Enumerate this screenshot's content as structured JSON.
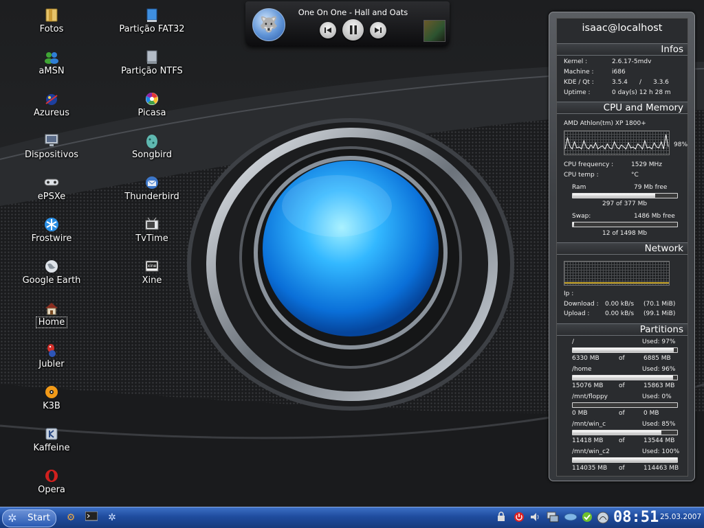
{
  "desktop": {
    "icons_left": [
      {
        "label": "Fotos",
        "icon": "folder-icon"
      },
      {
        "label": "aMSN",
        "icon": "amsn-icon"
      },
      {
        "label": "Azureus",
        "icon": "azureus-frog-icon"
      },
      {
        "label": "Dispositivos",
        "icon": "devices-monitor-icon"
      },
      {
        "label": "ePSXe",
        "icon": "gamepad-icon"
      },
      {
        "label": "Frostwire",
        "icon": "frostwire-icon"
      },
      {
        "label": "Google Earth",
        "icon": "globe-icon"
      },
      {
        "label": "Home",
        "icon": "home-icon"
      },
      {
        "label": "Jubler",
        "icon": "jubler-bird-icon"
      },
      {
        "label": "K3B",
        "icon": "k3b-disc-icon"
      },
      {
        "label": "Kaffeine",
        "icon": "kaffeine-icon"
      },
      {
        "label": "Opera",
        "icon": "opera-icon"
      }
    ],
    "icons_right": [
      {
        "label": "Partição FAT32",
        "icon": "drive-fat32-icon"
      },
      {
        "label": "Partição NTFS",
        "icon": "drive-ntfs-icon"
      },
      {
        "label": "Picasa",
        "icon": "picasa-icon"
      },
      {
        "label": "Songbird",
        "icon": "songbird-egg-icon"
      },
      {
        "label": "Thunderbird",
        "icon": "thunderbird-icon"
      },
      {
        "label": "TvTime",
        "icon": "tv-icon"
      },
      {
        "label": "Xine",
        "icon": "xine-icon"
      }
    ],
    "selected": "Home"
  },
  "player": {
    "track": "One On One - Hall and Oats",
    "logo_icon": "wolf-logo-icon",
    "prev_icon": "previous-track-icon",
    "pause_icon": "pause-icon",
    "next_icon": "next-track-icon"
  },
  "sysinfo": {
    "user": "isaac@localhost",
    "sections": {
      "infos": "Infos",
      "cpu_mem": "CPU and Memory",
      "network": "Network",
      "partitions": "Partitions"
    },
    "infos": {
      "kernel_label": "Kernel :",
      "kernel": "2.6.17-5mdv",
      "machine_label": "Machine :",
      "machine": "i686",
      "kde_label": "KDE / Qt :",
      "kde": "3.5.4",
      "qt_sep": "/",
      "qt": "3.3.6",
      "uptime_label": "Uptime :",
      "uptime": "0 day(s)  12 h 28 m"
    },
    "cpu": {
      "model": "AMD Athlon(tm) XP 1800+",
      "load": "98%",
      "freq_label": "CPU frequency :",
      "freq": "1529 MHz",
      "temp_label": "CPU temp :",
      "temp": "°C",
      "history": [
        0.2,
        0.75,
        0.35,
        0.2,
        0.55,
        0.25,
        0.3,
        0.2,
        0.6,
        0.3,
        0.2,
        0.4,
        0.25,
        0.5,
        0.2,
        0.3,
        0.35,
        0.2,
        0.45,
        0.25,
        0.2,
        0.55,
        0.3,
        0.2,
        0.4,
        0.3,
        0.2,
        0.5,
        0.25,
        0.3,
        0.2,
        0.45,
        0.35,
        0.2,
        0.6,
        0.25,
        0.3,
        0.2,
        0.5,
        0.3,
        0.25,
        0.55,
        0.2,
        0.9,
        0.3
      ]
    },
    "ram": {
      "label": "Ram",
      "free": "79 Mb free",
      "used": "297 of 377 Mb",
      "fraction": 0.79
    },
    "swap": {
      "label": "Swap:",
      "free": "1486 Mb free",
      "used": "12 of 1498 Mb",
      "fraction": 0.01
    },
    "network": {
      "ip_label": "Ip :",
      "down_label": "Download :",
      "down_rate": "0.00 kB/s",
      "down_total": "(70.1 MiB)",
      "up_label": "Upload :",
      "up_rate": "0.00 kB/s",
      "up_total": "(99.1 MiB)"
    },
    "partitions": [
      {
        "mount": "/",
        "used": "Used: 97%",
        "size": "6330 MB",
        "of": "of",
        "total": "6885 MB",
        "fraction": 0.97
      },
      {
        "mount": "/home",
        "used": "Used: 96%",
        "size": "15076 MB",
        "of": "of",
        "total": "15863 MB",
        "fraction": 0.96
      },
      {
        "mount": "/mnt/floppy",
        "used": "Used: 0%",
        "size": "0 MB",
        "of": "of",
        "total": "0 MB",
        "fraction": 0.0
      },
      {
        "mount": "/mnt/win_c",
        "used": "Used: 85%",
        "size": "11418 MB",
        "of": "of",
        "total": "13544 MB",
        "fraction": 0.85
      },
      {
        "mount": "/mnt/win_c2",
        "used": "Used: 100%",
        "size": "114035 MB",
        "of": "of",
        "total": "114463 MB",
        "fraction": 1.0
      }
    ]
  },
  "taskbar": {
    "start_label": "Start",
    "start_icon": "kde-start-icon",
    "quick_launch": [
      "cog-wheel-icon",
      "terminal-icon",
      "kde-gear-icon"
    ],
    "tray": [
      "lock-icon",
      "power-icon",
      "speaker-icon",
      "network-monitor-icon",
      "klipper-icon",
      "update-check-icon",
      "wifi-globe-icon"
    ],
    "clock": "08:51",
    "date": "25.03.2007"
  }
}
